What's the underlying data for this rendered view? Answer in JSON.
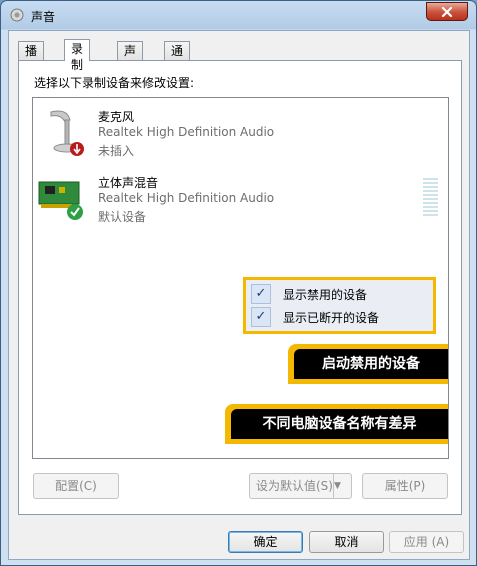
{
  "window": {
    "title": "声音",
    "close_icon": "close-icon"
  },
  "tabs": [
    {
      "label": "播放",
      "active": false
    },
    {
      "label": "录制",
      "active": true
    },
    {
      "label": "声音",
      "active": false
    },
    {
      "label": "通信",
      "active": false
    }
  ],
  "instruction": "选择以下录制设备来修改设置:",
  "devices": [
    {
      "name": "麦克风",
      "description": "Realtek High Definition Audio",
      "status": "未插入",
      "icon": "microphone-icon",
      "badge": "unplugged-badge-icon"
    },
    {
      "name": "立体声混音",
      "description": "Realtek High Definition Audio",
      "status": "默认设备",
      "icon": "sound-card-icon",
      "badge": "default-check-icon"
    }
  ],
  "context_menu": {
    "items": [
      {
        "label": "显示禁用的设备",
        "checked": true
      },
      {
        "label": "显示已断开的设备",
        "checked": true
      }
    ]
  },
  "annotations": {
    "enable_disabled": "启动禁用的设备",
    "name_varies": "不同电脑设备名称有差异"
  },
  "panel_buttons": {
    "configure": "配置(C)",
    "set_default": "设为默认值(S)",
    "properties": "属性(P)"
  },
  "dialog_buttons": {
    "ok": "确定",
    "cancel": "取消",
    "apply": "应用 (A)"
  },
  "colors": {
    "callout": "#f5b800",
    "banner_bg": "#000000",
    "banner_text": "#ffffff"
  }
}
